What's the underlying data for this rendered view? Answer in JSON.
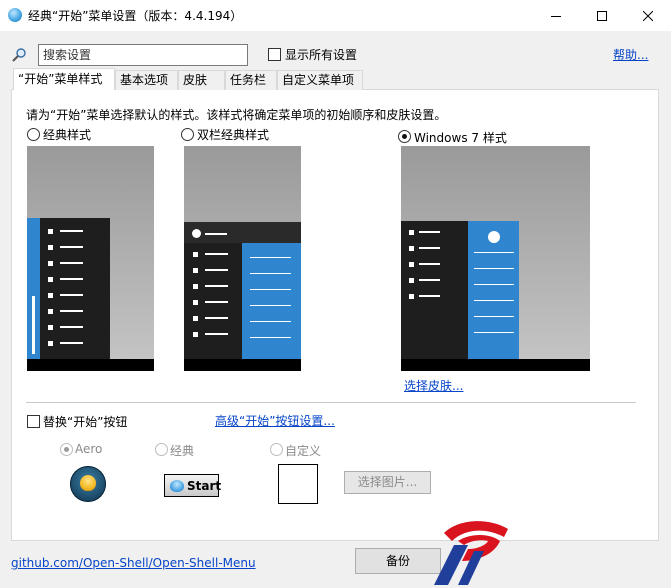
{
  "window": {
    "title": "经典“开始”菜单设置（版本：4.4.194）",
    "controls": [
      "minimize",
      "maximize",
      "close"
    ]
  },
  "search": {
    "placeholder": "搜索设置",
    "show_all_label": "显示所有设置",
    "show_all_checked": false
  },
  "help_link": "帮助...",
  "tabs": [
    {
      "label": "“开始”菜单样式",
      "active": true
    },
    {
      "label": "基本选项",
      "active": false
    },
    {
      "label": "皮肤",
      "active": false
    },
    {
      "label": "任务栏",
      "active": false
    },
    {
      "label": "自定义菜单项",
      "active": false
    }
  ],
  "menu_style": {
    "instruction": "请为“开始”菜单选择默认的样式。该样式将确定菜单项的初始顺序和皮肤设置。",
    "options": [
      {
        "label": "经典样式",
        "selected": false
      },
      {
        "label": "双栏经典样式",
        "selected": false
      },
      {
        "label": "Windows 7 样式",
        "selected": true
      }
    ],
    "select_skin_link": "选择皮肤..."
  },
  "start_button": {
    "replace_label": "替换“开始”按钮",
    "replace_checked": false,
    "advanced_link": "高级“开始”按钮设置...",
    "options": [
      {
        "label": "Aero",
        "selected": true
      },
      {
        "label": "经典",
        "selected": false
      },
      {
        "label": "自定义",
        "selected": false
      }
    ],
    "classic_button_text": "Start",
    "select_image_label": "选择图片..."
  },
  "footer": {
    "github_link": "github.com/Open-Shell/Open-Shell-Menu",
    "backup_label": "备份"
  },
  "colors": {
    "link": "#0645c8",
    "menu_dark": "#1e1e1e",
    "menu_blue": "#2f86cf",
    "watermark_red": "#d9141f",
    "watermark_blue": "#1f3f9b"
  }
}
